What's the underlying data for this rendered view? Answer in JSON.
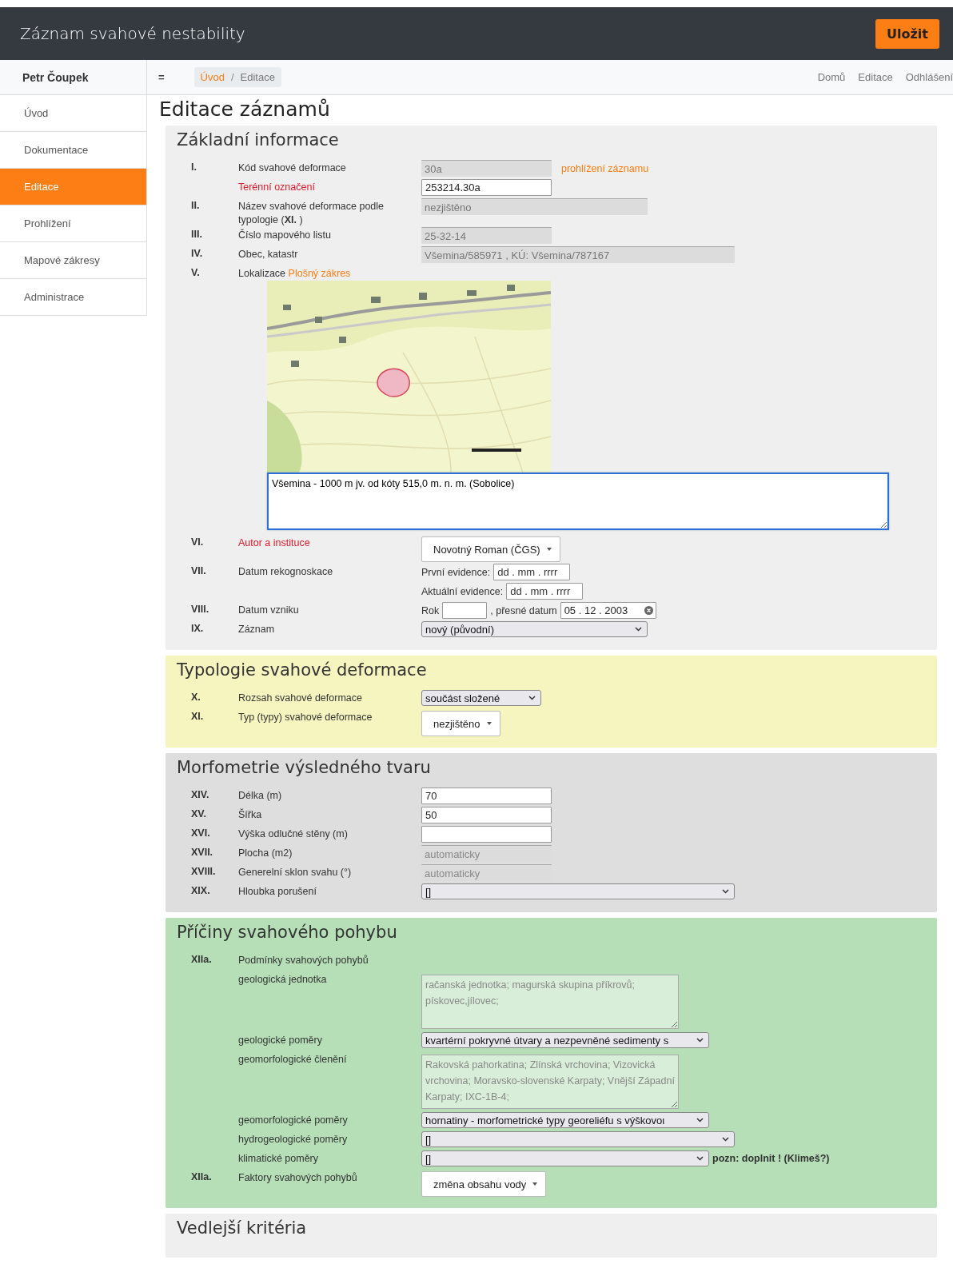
{
  "app": {
    "title": "Záznam svahové nestability",
    "save_button": "Uložit"
  },
  "sidebar": {
    "user": "Petr Čoupek",
    "items": [
      {
        "label": "Úvod",
        "selected": false
      },
      {
        "label": "Dokumentace",
        "selected": false
      },
      {
        "label": "Editace",
        "selected": true
      },
      {
        "label": "Prohlížení",
        "selected": false
      },
      {
        "label": "Mapové zákresy",
        "selected": false
      },
      {
        "label": "Administrace",
        "selected": false
      }
    ]
  },
  "topnav": {
    "toggle": "=",
    "breadcrumb": [
      {
        "label": "Úvod",
        "current": false
      },
      {
        "label": "Editace",
        "current": true
      }
    ],
    "breadcrumb_separator": "/",
    "links": [
      "Domů",
      "Editace",
      "Odhlášení"
    ]
  },
  "page_title": "Editace záznamů",
  "sections": [
    {
      "title": "Základní informace",
      "color": "#efefef",
      "rows": [
        {
          "number": "I.",
          "label": "Kód svahové deformace",
          "required": false,
          "controls": [
            {
              "kind": "readonly",
              "value": "30a"
            },
            {
              "kind": "link",
              "text": "prohlížení záznamu"
            }
          ]
        },
        {
          "label": "Terénní označení",
          "required": true,
          "controls": [
            {
              "kind": "input",
              "value": "253214.30a"
            }
          ]
        },
        {
          "number": "II.",
          "label": "Název svahové deformace podle typologie (**XI.** )",
          "required": false,
          "controls": [
            {
              "kind": "readonly",
              "value": "nezjištěno"
            }
          ]
        },
        {
          "number": "III.",
          "label": "Číslo mapového listu",
          "required": false,
          "controls": [
            {
              "kind": "readonly",
              "value": "25-32-14"
            }
          ]
        },
        {
          "number": "IV.",
          "label": "Obec, katastr",
          "required": false,
          "controls": [
            {
              "kind": "readonly",
              "value": "Všemina/585971 , KÚ: Všemina/787167"
            }
          ]
        },
        {
          "number": "V.",
          "label": "Lokalizace",
          "link": "Plošný zákres",
          "required": false,
          "below": [
            {
              "kind": "picture"
            },
            {
              "kind": "textarea",
              "value": "Všemina - 1000 m jv. od kóty 515,0 m. n. m. (Sobolice)",
              "readonly": false,
              "focused": true
            }
          ]
        },
        {
          "number": "VI.",
          "label": "Autor a instituce",
          "required": true,
          "controls": [
            {
              "kind": "dropdown",
              "value": "Novotný Roman (ČGS)"
            }
          ]
        },
        {
          "number": "VII.",
          "label": "Datum rekognoskace",
          "required": false,
          "controls": [
            {
              "kind": "label",
              "text": "První evidence:"
            },
            {
              "kind": "date",
              "placeholder": "dd . mm . rrrr",
              "clearable": false
            }
          ]
        },
        {
          "controls": [
            {
              "kind": "label",
              "text": "Aktuální evidence:"
            },
            {
              "kind": "date",
              "placeholder": "dd . mm . rrrr",
              "clearable": false
            }
          ]
        },
        {
          "number": "VIII.",
          "label": "Datum vzniku",
          "required": false,
          "controls": [
            {
              "kind": "label",
              "text": "Rok"
            },
            {
              "kind": "input"
            },
            {
              "kind": "label",
              "text": ", přesné datum"
            },
            {
              "kind": "date",
              "value": "05 . 12 . 2003",
              "clearable": true
            }
          ]
        },
        {
          "number": "IX.",
          "label": "Záznam",
          "required": false,
          "controls": [
            {
              "kind": "select",
              "value": "nový (původní)"
            }
          ]
        }
      ]
    },
    {
      "title": "Typologie svahové deformace",
      "color": "#f6f4bf",
      "rows": [
        {
          "number": "X.",
          "label": "Rozsah svahové deformace",
          "required": false,
          "controls": [
            {
              "kind": "select",
              "value": "součást složené"
            }
          ]
        },
        {
          "number": "XI.",
          "label": "Typ (typy) svahové deformace",
          "required": false,
          "controls": [
            {
              "kind": "dropdown",
              "value": "nezjištěno"
            }
          ]
        }
      ]
    },
    {
      "title": "Morfometrie výsledného tvaru",
      "color": "#dedede",
      "rows": [
        {
          "number": "XIV.",
          "label": "Délka (m)",
          "required": false,
          "controls": [
            {
              "kind": "input",
              "value": "70"
            }
          ]
        },
        {
          "number": "XV.",
          "label": "Šířka",
          "required": false,
          "controls": [
            {
              "kind": "input",
              "value": "50"
            }
          ]
        },
        {
          "number": "XVI.",
          "label": "Výška odlučné stěny (m)",
          "required": false,
          "controls": [
            {
              "kind": "input"
            }
          ]
        },
        {
          "number": "XVII.",
          "label": "Plocha (m2)",
          "required": false,
          "controls": [
            {
              "kind": "readonly",
              "placeholder": "automaticky"
            }
          ]
        },
        {
          "number": "XVIII.",
          "label": "Generelní sklon svahu (°)",
          "required": false,
          "controls": [
            {
              "kind": "readonly",
              "placeholder": "automaticky"
            }
          ]
        },
        {
          "number": "XIX.",
          "label": "Hloubka porušení",
          "required": false,
          "controls": [
            {
              "kind": "select",
              "value": "[]"
            }
          ]
        }
      ]
    },
    {
      "title": "Příčiny svahového pohybu",
      "color": "#b6dfb8",
      "rows": [
        {
          "number": "XIIa.",
          "label": "Podmínky svahových pohybů",
          "required": false
        },
        {
          "label": "geologická jednotka",
          "required": false,
          "controls": [
            {
              "kind": "textarea",
              "value": "račanská jednotka; magurská skupina příkrovů; pískovec,jílovec;",
              "readonly": true,
              "focused": false
            }
          ]
        },
        {
          "label": "geologické poměry",
          "required": false,
          "controls": [
            {
              "kind": "select",
              "value": "kvartérní pokryvné útvary a nezpevněné sedimenty s"
            }
          ]
        },
        {
          "label": "geomorfologické členění",
          "required": false,
          "controls": [
            {
              "kind": "textarea",
              "value": "Rakovská pahorkatina; Zlínská vrchovina; Vizovická vrchovina; Moravsko-slovenské Karpaty; Vnější Západní Karpaty; IXC-1B-4;",
              "readonly": true,
              "focused": false
            }
          ]
        },
        {
          "label": "geomorfologické poměry",
          "required": false,
          "controls": [
            {
              "kind": "select",
              "value": "hornatiny - morfometrické typy georeliéfu s výškovoι"
            }
          ]
        },
        {
          "label": "hydrogeologické poměry",
          "required": false,
          "controls": [
            {
              "kind": "select",
              "value": "[]"
            }
          ]
        },
        {
          "label": "klimatické poměry",
          "required": false,
          "controls": [
            {
              "kind": "select",
              "value": "[]"
            },
            {
              "kind": "note",
              "text": "pozn: doplnit ! (Klimeš?)"
            }
          ]
        },
        {
          "number": "XIIa.",
          "label": "Faktory svahových pohybů",
          "required": false,
          "controls": [
            {
              "kind": "dropdown",
              "value": "změna obsahu vody"
            }
          ]
        }
      ]
    },
    {
      "title": "Vedlejší kritéria",
      "color": "#efefef"
    }
  ]
}
